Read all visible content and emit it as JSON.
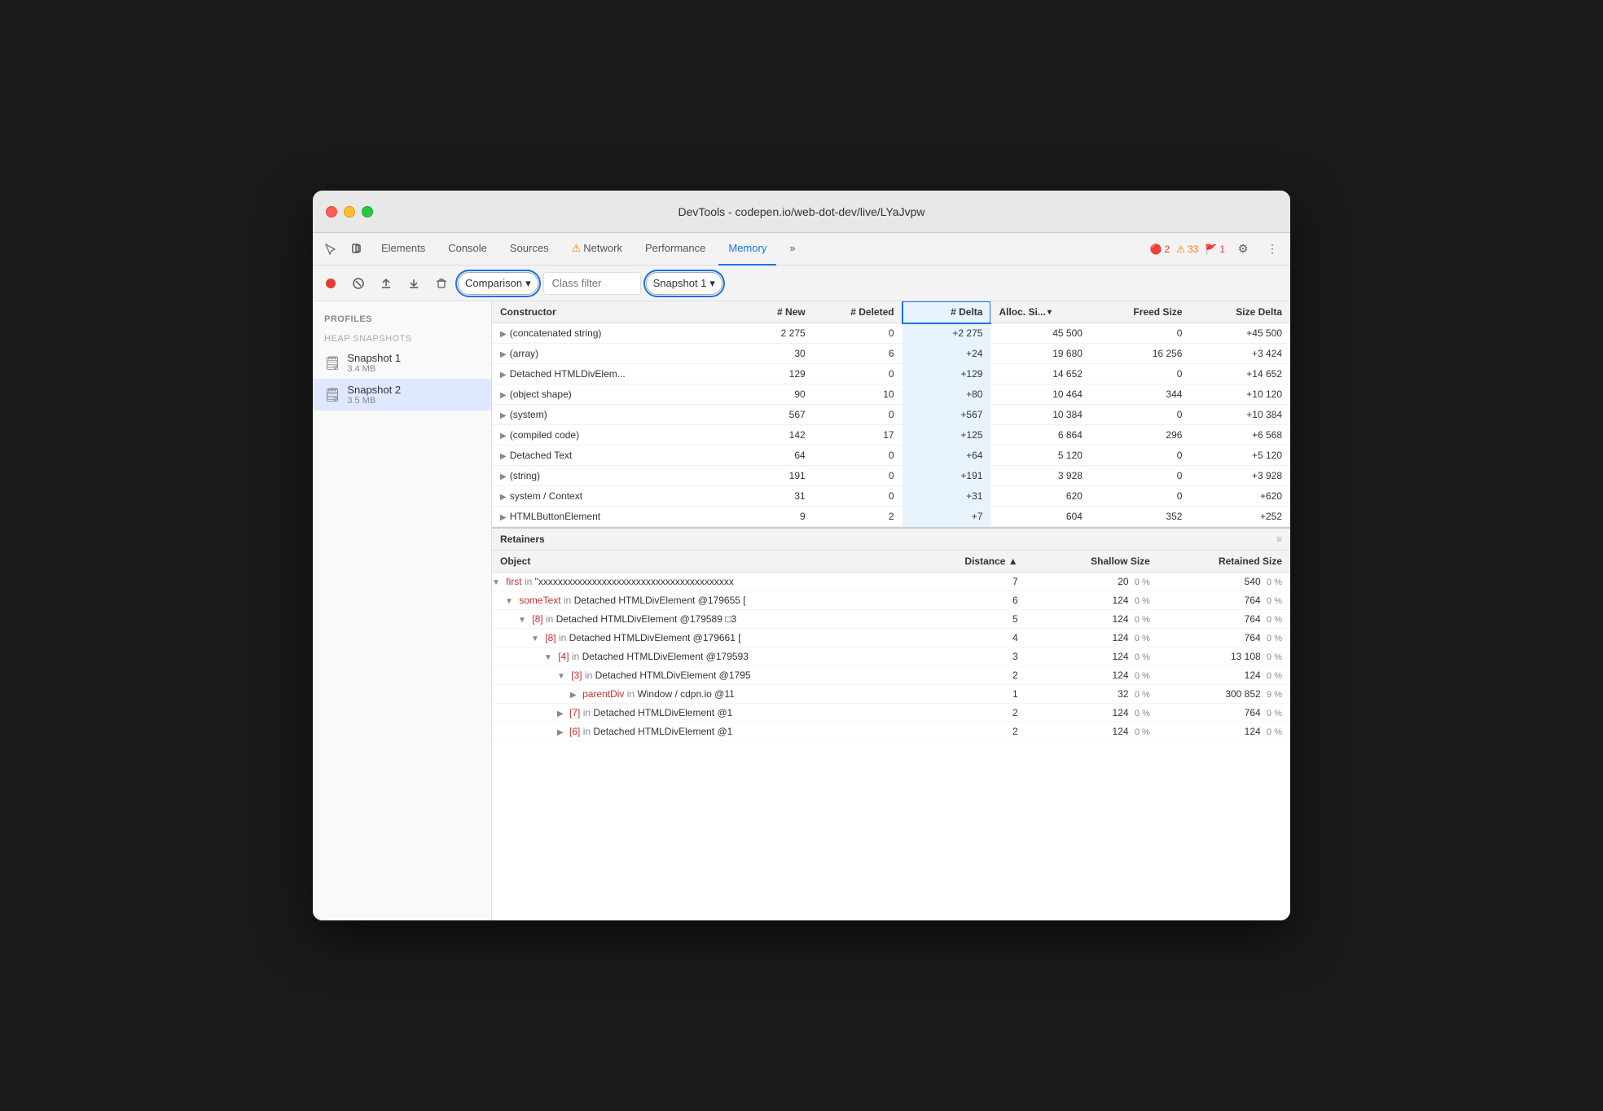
{
  "window": {
    "title": "DevTools - codepen.io/web-dot-dev/live/LYaJvpw"
  },
  "toolbar": {
    "tabs": [
      "Elements",
      "Console",
      "Sources",
      "Network",
      "Performance",
      "Memory",
      "»"
    ],
    "active_tab": "Memory",
    "error_count": "2",
    "warning_count": "33",
    "info_count": "1"
  },
  "second_toolbar": {
    "comparison_label": "Comparison",
    "class_filter_placeholder": "Class filter",
    "snapshot_label": "Snapshot 1"
  },
  "table_headers": {
    "constructor": "Constructor",
    "new": "# New",
    "deleted": "# Deleted",
    "delta": "# Delta",
    "alloc_size": "Alloc. Si...",
    "freed_size": "Freed Size",
    "size_delta": "Size Delta"
  },
  "rows": [
    {
      "constructor": "(concatenated string)",
      "new": "2 275",
      "deleted": "0",
      "delta": "+2 275",
      "alloc_size": "45 500",
      "freed_size": "0",
      "size_delta": "+45 500"
    },
    {
      "constructor": "(array)",
      "new": "30",
      "deleted": "6",
      "delta": "+24",
      "alloc_size": "19 680",
      "freed_size": "16 256",
      "size_delta": "+3 424"
    },
    {
      "constructor": "Detached HTMLDivElem...",
      "new": "129",
      "deleted": "0",
      "delta": "+129",
      "alloc_size": "14 652",
      "freed_size": "0",
      "size_delta": "+14 652"
    },
    {
      "constructor": "(object shape)",
      "new": "90",
      "deleted": "10",
      "delta": "+80",
      "alloc_size": "10 464",
      "freed_size": "344",
      "size_delta": "+10 120"
    },
    {
      "constructor": "(system)",
      "new": "567",
      "deleted": "0",
      "delta": "+567",
      "alloc_size": "10 384",
      "freed_size": "0",
      "size_delta": "+10 384"
    },
    {
      "constructor": "(compiled code)",
      "new": "142",
      "deleted": "17",
      "delta": "+125",
      "alloc_size": "6 864",
      "freed_size": "296",
      "size_delta": "+6 568"
    },
    {
      "constructor": "Detached Text",
      "new": "64",
      "deleted": "0",
      "delta": "+64",
      "alloc_size": "5 120",
      "freed_size": "0",
      "size_delta": "+5 120"
    },
    {
      "constructor": "(string)",
      "new": "191",
      "deleted": "0",
      "delta": "+191",
      "alloc_size": "3 928",
      "freed_size": "0",
      "size_delta": "+3 928"
    },
    {
      "constructor": "system / Context",
      "new": "31",
      "deleted": "0",
      "delta": "+31",
      "alloc_size": "620",
      "freed_size": "0",
      "size_delta": "+620"
    },
    {
      "constructor": "HTMLButtonElement",
      "new": "9",
      "deleted": "2",
      "delta": "+7",
      "alloc_size": "604",
      "freed_size": "352",
      "size_delta": "+252"
    }
  ],
  "retainers_section": {
    "title": "Retainers",
    "headers": {
      "object": "Object",
      "distance": "Distance",
      "shallow_size": "Shallow Size",
      "retained_size": "Retained Size"
    },
    "rows": [
      {
        "indent": 0,
        "expand": "▼",
        "keyword": "first",
        "middle": " in ",
        "object": "\"xxxxxxxxxxxxxxxxxxxxxxxxxxxxxxxxxxxxxxxx",
        "distance": "7",
        "shallow": "20",
        "shallow_pct": "0 %",
        "retained": "540",
        "retained_pct": "0 %"
      },
      {
        "indent": 1,
        "expand": "▼",
        "keyword": "someText",
        "middle": " in ",
        "object": "Detached HTMLDivElement @179655 [",
        "distance": "6",
        "shallow": "124",
        "shallow_pct": "0 %",
        "retained": "764",
        "retained_pct": "0 %"
      },
      {
        "indent": 2,
        "expand": "▼",
        "keyword": "[8]",
        "middle": " in ",
        "object": "Detached HTMLDivElement @179589 □3",
        "distance": "5",
        "shallow": "124",
        "shallow_pct": "0 %",
        "retained": "764",
        "retained_pct": "0 %"
      },
      {
        "indent": 3,
        "expand": "▼",
        "keyword": "[8]",
        "middle": " in ",
        "object": "Detached HTMLDivElement @179661 [",
        "distance": "4",
        "shallow": "124",
        "shallow_pct": "0 %",
        "retained": "764",
        "retained_pct": "0 %"
      },
      {
        "indent": 4,
        "expand": "▼",
        "keyword": "[4]",
        "middle": " in ",
        "object": "Detached HTMLDivElement @179593",
        "distance": "3",
        "shallow": "124",
        "shallow_pct": "0 %",
        "retained": "13 108",
        "retained_pct": "0 %"
      },
      {
        "indent": 5,
        "expand": "▼",
        "keyword": "[3]",
        "middle": " in ",
        "object": "Detached HTMLDivElement @1795",
        "distance": "2",
        "shallow": "124",
        "shallow_pct": "0 %",
        "retained": "124",
        "retained_pct": "0 %"
      },
      {
        "indent": 6,
        "expand": "▶",
        "keyword": "parentDiv",
        "middle": " in ",
        "object": "Window / cdpn.io @11",
        "distance": "1",
        "shallow": "32",
        "shallow_pct": "0 %",
        "retained": "300 852",
        "retained_pct": "9 %"
      },
      {
        "indent": 5,
        "expand": "▶",
        "keyword": "[7]",
        "middle": " in ",
        "object": "Detached HTMLDivElement @1",
        "distance": "2",
        "shallow": "124",
        "shallow_pct": "0 %",
        "retained": "764",
        "retained_pct": "0 %"
      },
      {
        "indent": 5,
        "expand": "▶",
        "keyword": "[6]",
        "middle": " in ",
        "object": "Detached HTMLDivElement @1",
        "distance": "2",
        "shallow": "124",
        "shallow_pct": "0 %",
        "retained": "124",
        "retained_pct": "0 %"
      }
    ]
  },
  "sidebar": {
    "profiles_title": "Profiles",
    "heap_snapshots_title": "HEAP SNAPSHOTS",
    "snapshots": [
      {
        "name": "Snapshot 1",
        "size": "3.4 MB"
      },
      {
        "name": "Snapshot 2",
        "size": "3.5 MB"
      }
    ]
  }
}
